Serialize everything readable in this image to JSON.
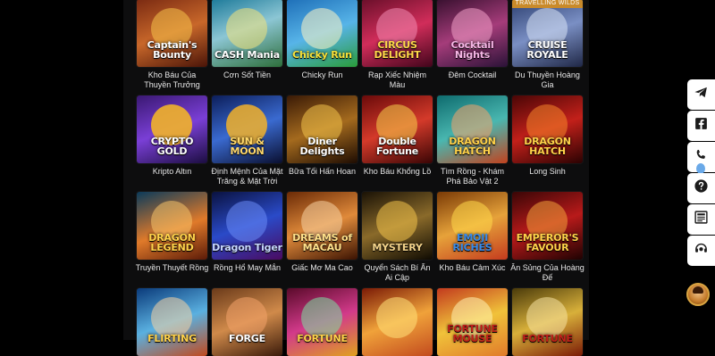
{
  "games": [
    {
      "name": "Kho Báu Của Thuyền Trưởng",
      "logo": "Captain's Bounty",
      "badge": ""
    },
    {
      "name": "Cơn Sốt Tiền",
      "logo": "CASH Mania",
      "badge": ""
    },
    {
      "name": "Chicky Run",
      "logo": "Chicky Run",
      "badge": ""
    },
    {
      "name": "Rạp Xiếc Nhiệm Màu",
      "logo": "CIRCUS DELIGHT",
      "badge": ""
    },
    {
      "name": "Đêm Cocktail",
      "logo": "Cocktail Nights",
      "badge": ""
    },
    {
      "name": "Du Thuyền Hoàng Gia",
      "logo": "CRUISE ROYALE",
      "badge": "TRAVELLING WILDS"
    },
    {
      "name": "Kripto Altın",
      "logo": "CRYPTO GOLD",
      "badge": ""
    },
    {
      "name": "Định Mệnh Của Mặt Trăng & Mặt Trời",
      "logo": "SUN & MOON",
      "badge": ""
    },
    {
      "name": "Bữa Tối Hấn Hoan",
      "logo": "Diner Delights",
      "badge": ""
    },
    {
      "name": "Kho Báu Khổng Lồ",
      "logo": "Double Fortune",
      "badge": ""
    },
    {
      "name": "Tìm Rồng - Khám Phá Bảo Vật 2",
      "logo": "DRAGON HATCH",
      "badge": ""
    },
    {
      "name": "Long Sinh",
      "logo": "DRAGON HATCH",
      "badge": ""
    },
    {
      "name": "Truyền Thuyết Rồng",
      "logo": "DRAGON LEGEND",
      "badge": ""
    },
    {
      "name": "Rồng Hổ May Mắn",
      "logo": "Dragon Tiger",
      "badge": ""
    },
    {
      "name": "Giấc Mơ Ma Cao",
      "logo": "DREAMS of MACAU",
      "badge": ""
    },
    {
      "name": "Quyển Sách Bí Ẩn Ai Cập",
      "logo": "MYSTERY",
      "badge": ""
    },
    {
      "name": "Kho Báu Cảm Xúc",
      "logo": "EMOJI RICHES",
      "badge": ""
    },
    {
      "name": "Ân Sủng Của Hoàng Đế",
      "logo": "EMPEROR'S FAVOUR",
      "badge": ""
    },
    {
      "name": "",
      "logo": "FLIRTING",
      "badge": ""
    },
    {
      "name": "",
      "logo": "FORGE",
      "badge": ""
    },
    {
      "name": "",
      "logo": "FORTUNE",
      "badge": ""
    },
    {
      "name": "",
      "logo": "",
      "badge": ""
    },
    {
      "name": "",
      "logo": "FORTUNE MOUSE",
      "badge": ""
    },
    {
      "name": "",
      "logo": "FORTUNE",
      "badge": ""
    }
  ],
  "side_buttons": [
    "telegram-icon",
    "facebook-icon",
    "phone-icon",
    "help-icon",
    "news-icon",
    "support-headset-icon"
  ],
  "colors": {
    "page_bg": "#000000",
    "panel_bg": "#0d0d0e",
    "label": "#e6e6e6"
  }
}
